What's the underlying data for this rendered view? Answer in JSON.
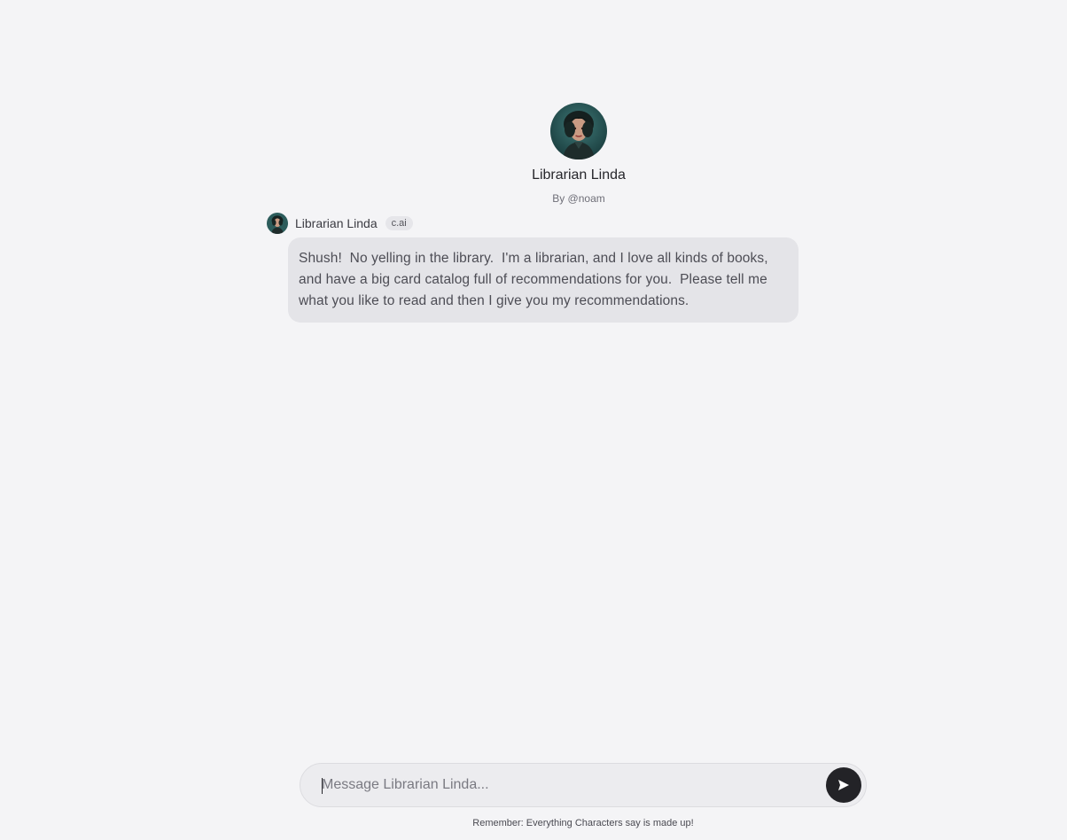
{
  "character": {
    "name": "Librarian Linda",
    "author": "By @noam",
    "avatar_icon": "character-portrait-avatar"
  },
  "messages": [
    {
      "author": "Librarian Linda",
      "badge": "c.ai",
      "text": "Shush!  No yelling in the library.  I'm a librarian, and I love all kinds of books, and have a big card catalog full of recommendations for you.  Please tell me what you like to read and then I give you my recommendations."
    }
  ],
  "composer": {
    "placeholder": "Message Librarian Linda...",
    "value": "",
    "send_icon": "send-arrow-icon"
  },
  "footer": {
    "disclaimer": "Remember: Everything Characters say is made up!"
  },
  "colors": {
    "background": "#f4f4f6",
    "bubble": "#e4e4e8",
    "send_button": "#232327"
  }
}
